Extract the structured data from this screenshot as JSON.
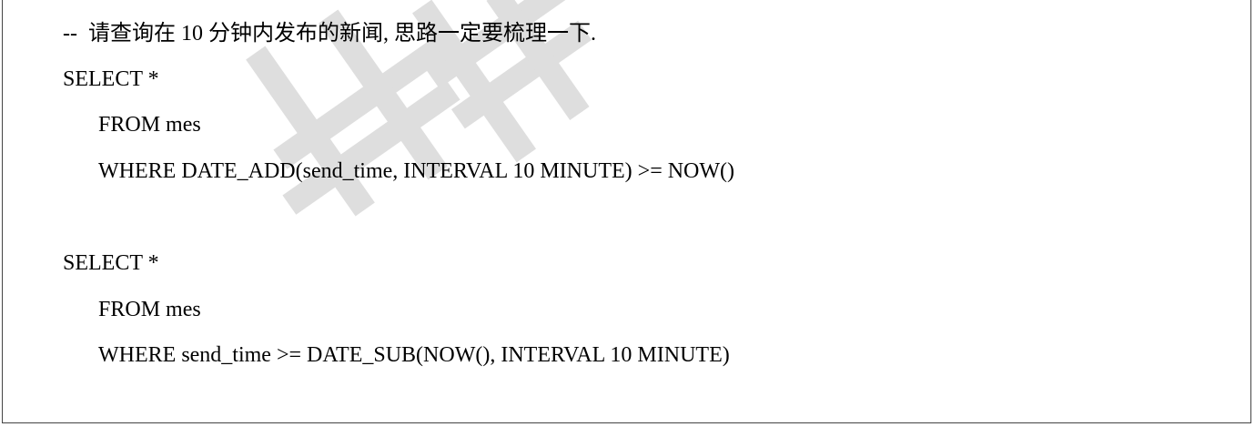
{
  "document": {
    "watermark_color": "#d9d9d9",
    "lines": [
      "--  请查询在 10 分钟内发布的新闻, 思路一定要梳理一下.",
      "SELECT *",
      "FROM mes",
      "WHERE DATE_ADD(send_time, INTERVAL 10 MINUTE) >= NOW()",
      "SELECT *",
      "FROM mes",
      "WHERE send_time >= DATE_SUB(NOW(), INTERVAL 10 MINUTE)"
    ]
  }
}
